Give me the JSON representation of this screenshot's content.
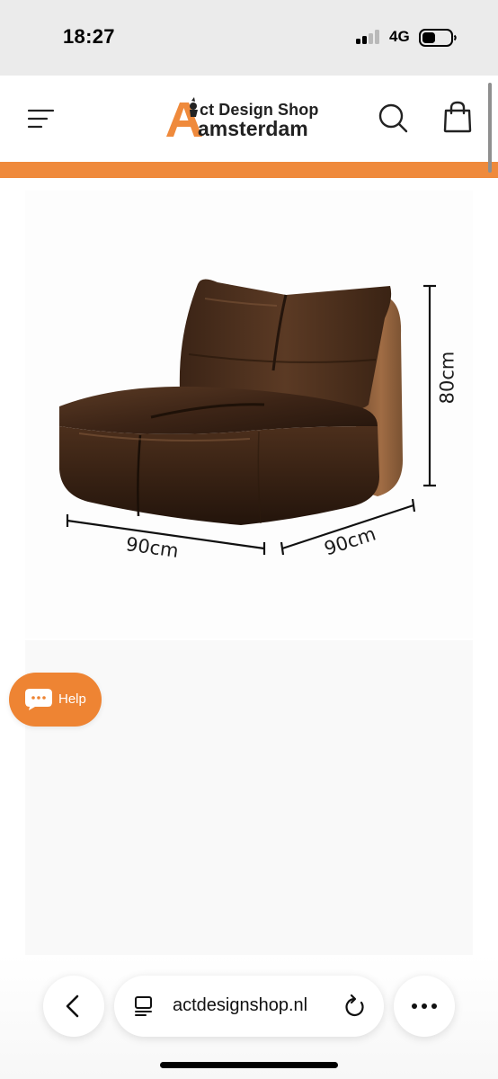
{
  "status_bar": {
    "time": "18:27",
    "network": "4G",
    "icons": [
      "signal-icon",
      "battery-icon"
    ]
  },
  "header": {
    "menu_icon": "hamburger-menu-icon",
    "logo_line1": "ct Design Shop",
    "logo_line2": "amsterdam",
    "logo_initial": "A",
    "search_icon": "search-icon",
    "cart_icon": "shopping-bag-icon",
    "accent_color": "#ef8a3c"
  },
  "product": {
    "dimension_width": "90cm",
    "dimension_depth": "90cm",
    "dimension_height": "80cm"
  },
  "help_widget": {
    "label": "Help",
    "icon": "chat-bubble-icon",
    "color": "#ee8433"
  },
  "browser": {
    "url": "actdesignshop.nl",
    "back_icon": "chevron-left-icon",
    "tab_icon": "tab-overview-icon",
    "reload_icon": "reload-icon",
    "more_icon": "more-dots-icon"
  }
}
